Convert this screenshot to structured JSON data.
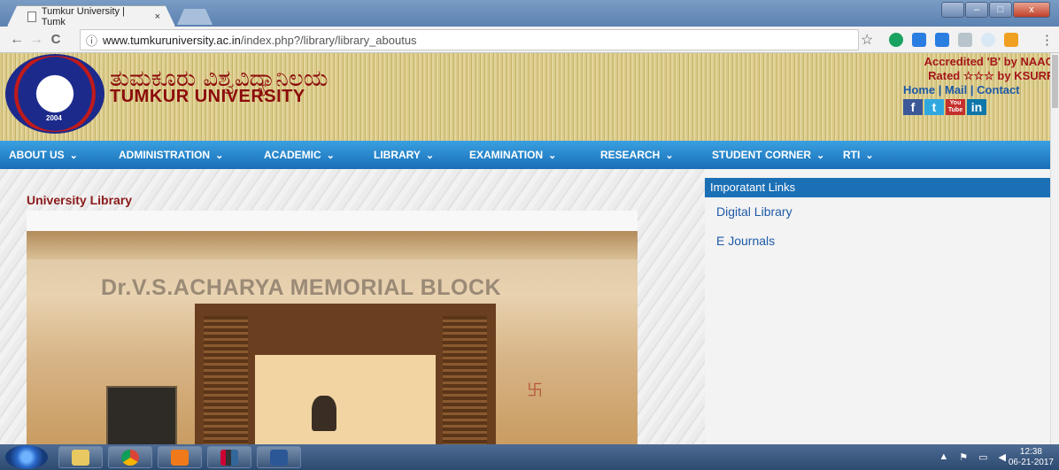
{
  "browser": {
    "tab_title": "Tumkur University | Tumk",
    "tab_close": "×",
    "url_host": "www.tumkuruniversity.ac.in",
    "url_path": "/index.php?/library/library_aboutus",
    "back_icon": "←",
    "forward_icon": "→",
    "reload_icon": "C",
    "info_icon": "ⓘ",
    "star_icon": "☆",
    "menu_icon": "⋮",
    "win_min": "–",
    "win_max": "□",
    "win_close": "x"
  },
  "site": {
    "kannada_title": "ತುಮಕೂರು ವಿಶ್ವವಿದ್ಯಾನಿಲಯ",
    "english_title": "TUMKUR UNIVERSITY",
    "logo_year": "2004",
    "accreditation": "Accredited 'B' by NAAC",
    "rated": "Rated ☆☆☆ by KSURF",
    "top_links": [
      "Home",
      "Mail",
      "Contact"
    ],
    "social": [
      "f",
      "t",
      "You Tube",
      "in"
    ]
  },
  "nav": {
    "items": [
      {
        "label": "ABOUT US",
        "chev": "⌄"
      },
      {
        "label": "ADMINISTRATION",
        "chev": "⌄"
      },
      {
        "label": "ACADEMIC",
        "chev": "⌄"
      },
      {
        "label": "LIBRARY",
        "chev": "⌄"
      },
      {
        "label": "EXAMINATION",
        "chev": "⌄"
      },
      {
        "label": "RESEARCH",
        "chev": "⌄"
      },
      {
        "label": "STUDENT CORNER",
        "chev": "⌄"
      },
      {
        "label": "RTI",
        "chev": "⌄"
      }
    ]
  },
  "main": {
    "heading": "University Library",
    "photo_sign": "Dr.V.S.ACHARYA MEMORIAL BLOCK",
    "swastik": "卐"
  },
  "sidebar": {
    "title": "Imporatant Links",
    "links": [
      "Digital Library",
      "E Journals"
    ]
  },
  "taskbar": {
    "time": "12:38",
    "date": "06-21-2017"
  },
  "colors": {
    "nav_blue": "#1a6fb8",
    "title_red": "#8c0b0b",
    "link_blue": "#1e5aa8"
  }
}
